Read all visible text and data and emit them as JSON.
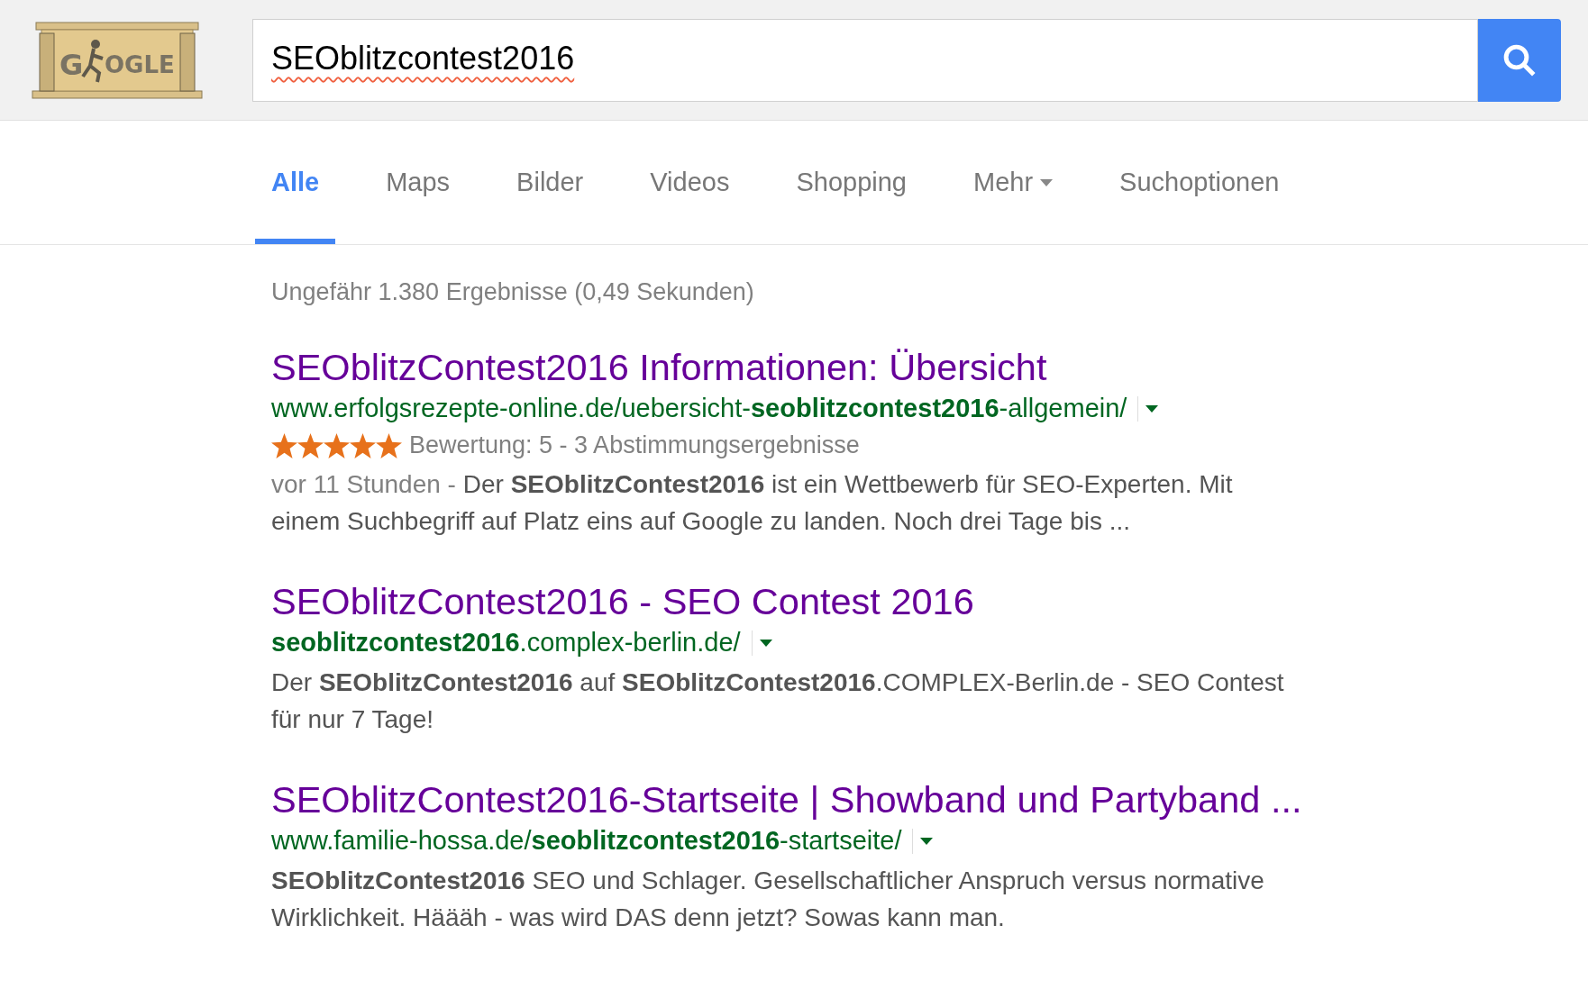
{
  "logo": {
    "left": "G",
    "right": "OGLE"
  },
  "search": {
    "value": "SEOblitzcontest2016",
    "misspelled": true
  },
  "tabs": [
    {
      "label": "Alle",
      "selected": true,
      "caret": false
    },
    {
      "label": "Maps",
      "selected": false,
      "caret": false
    },
    {
      "label": "Bilder",
      "selected": false,
      "caret": false
    },
    {
      "label": "Videos",
      "selected": false,
      "caret": false
    },
    {
      "label": "Shopping",
      "selected": false,
      "caret": false
    },
    {
      "label": "Mehr",
      "selected": false,
      "caret": true
    },
    {
      "label": "Suchoptionen",
      "selected": false,
      "caret": false
    }
  ],
  "result_stats": "Ungefähr 1.380 Ergebnisse (0,49 Sekunden)",
  "results": [
    {
      "title": "SEOblitzContest2016 Informationen: Übersicht",
      "url": "www.erfolgsrezepte-online.de/uebersicht-**seoblitzcontest2016**-allgemein/",
      "stars": 5,
      "rating": "Bewertung: 5 - 3 Abstimmungsergebnisse",
      "date": "vor 11 Stunden - ",
      "snippet": "Der **SEOblitzContest2016** ist ein Wettbewerb für SEO-Experten. Mit einem Suchbegriff auf Platz eins auf Google zu landen. Noch drei Tage bis ..."
    },
    {
      "title": "SEOblitzContest2016 - SEO Contest 2016",
      "url": "**seoblitzcontest2016**.complex-berlin.de/",
      "snippet": "Der **SEOblitzContest2016** auf **SEOblitzContest2016**.COMPLEX-Berlin.de - SEO Contest für nur 7 Tage!"
    },
    {
      "title": "SEOblitzContest2016-Startseite | Showband und Partyband ...",
      "url": "www.familie-hossa.de/**seoblitzcontest2016**-startseite/",
      "snippet": "**SEOblitzContest2016** SEO und Schlager. Gesellschaftlicher Anspruch versus normative Wirklichkeit. Häääh - was wird DAS denn jetzt? Sowas kann man."
    }
  ]
}
